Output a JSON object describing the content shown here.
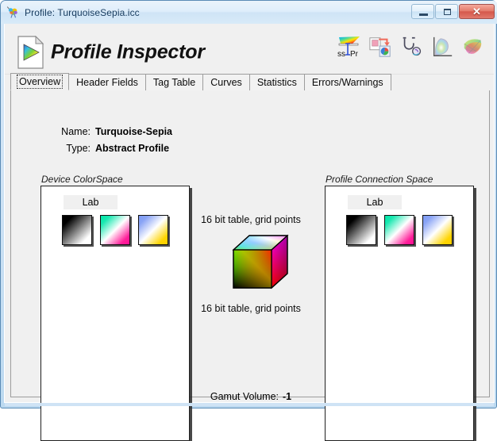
{
  "window": {
    "title": "Profile: TurquoiseSepia.icc",
    "icon": "brain-color-icon",
    "controls": {
      "minimize": "–",
      "maximize": "□",
      "close": "✕"
    }
  },
  "header": {
    "app_title": "Profile Inspector",
    "logo_icon": "color-profile-document-icon",
    "toolbar": [
      {
        "name": "profile-assistant-button",
        "icon": "ssPr-gamut-icon",
        "label": "ssPr"
      },
      {
        "name": "apply-profile-button",
        "icon": "apply-profile-icon",
        "label": ""
      },
      {
        "name": "profile-doctor-button",
        "icon": "stethoscope-icon",
        "label": ""
      },
      {
        "name": "chromaticity-diagram-button",
        "icon": "2d-gamut-plot-icon",
        "label": ""
      },
      {
        "name": "gamut-viewer-button",
        "icon": "3d-gamut-icon",
        "label": ""
      }
    ]
  },
  "tabs": [
    {
      "label": "Overview",
      "active": true
    },
    {
      "label": "Header Fields",
      "active": false
    },
    {
      "label": "Tag Table",
      "active": false
    },
    {
      "label": "Curves",
      "active": false
    },
    {
      "label": "Statistics",
      "active": false
    },
    {
      "label": "Errors/Warnings",
      "active": false
    }
  ],
  "overview": {
    "name_label": "Name:",
    "name_value": "Turquoise-Sepia",
    "type_label": "Type:",
    "type_value": "Abstract Profile",
    "device_colorspace": {
      "caption": "Device ColorSpace",
      "tag": "Lab",
      "channels": [
        {
          "name": "lightness-swatch",
          "channel": "L"
        },
        {
          "name": "a-axis-swatch",
          "channel": "a"
        },
        {
          "name": "b-axis-swatch",
          "channel": "b"
        }
      ]
    },
    "profile_connection_space": {
      "caption": "Profile Connection Space",
      "tag": "Lab",
      "channels": [
        {
          "name": "lightness-swatch",
          "channel": "L"
        },
        {
          "name": "a-axis-swatch",
          "channel": "a"
        },
        {
          "name": "b-axis-swatch",
          "channel": "b"
        }
      ]
    },
    "a2b_text": "16 bit table,  grid points",
    "b2a_text": "16 bit table,  grid points",
    "cube_icon": "rgb-color-cube",
    "gamut_volume_label": "Gamut Volume:",
    "gamut_volume_value": "-1"
  },
  "colors": {
    "window_frame": "#cfe3f5",
    "client_bg": "#f0f0f0",
    "panel_bg": "#ffffff",
    "border": "#9d9d9d",
    "title_text": "#173b5e",
    "close_button": "#d4574a"
  }
}
